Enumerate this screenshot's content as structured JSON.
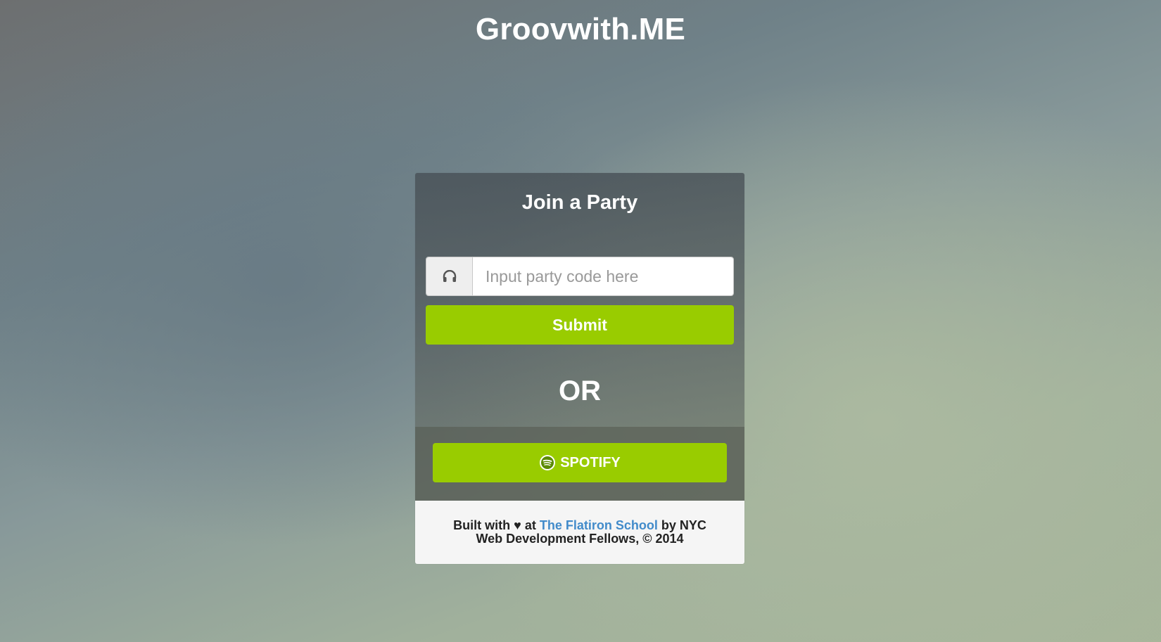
{
  "header": {
    "brand": "Groovwith.ME"
  },
  "join_card": {
    "title": "Join a Party",
    "input": {
      "placeholder": "Input party code here",
      "value": "",
      "icon": "headphones-icon"
    },
    "submit_label": "Submit",
    "or_text": "OR",
    "spotify": {
      "label": "SPOTIFY",
      "icon": "spotify-icon"
    }
  },
  "footer": {
    "prefix": "Built with",
    "heart": "♥",
    "at": "at",
    "link_text": "The Flatiron School",
    "suffix": "by NYC Web Development Fellows, © 2014"
  },
  "colors": {
    "accent_green": "#99cc00",
    "link_blue": "#428bca",
    "footer_bg": "#f5f5f5"
  }
}
